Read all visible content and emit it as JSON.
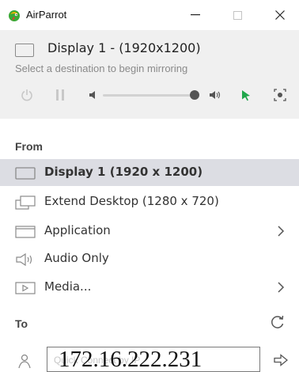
{
  "window": {
    "title": "AirParrot",
    "controls": {
      "minimize": "—",
      "maximize": "☐",
      "close": "✕"
    }
  },
  "status": {
    "display_title": "Display 1 - (1920x1200)",
    "subtitle": "Select a destination to begin mirroring",
    "volume_level": 0.98,
    "accent_color": "#1fa64a"
  },
  "from": {
    "label": "From",
    "items": [
      {
        "label": "Display 1 (1920 x 1200)",
        "icon": "display-icon",
        "selected": true,
        "has_submenu": false
      },
      {
        "label": "Extend Desktop (1280 x 720)",
        "icon": "extend-desktop-icon",
        "selected": false,
        "has_submenu": false
      },
      {
        "label": "Application",
        "icon": "application-icon",
        "selected": false,
        "has_submenu": true
      },
      {
        "label": "Audio Only",
        "icon": "speaker-icon",
        "selected": false,
        "has_submenu": false
      },
      {
        "label": "Media...",
        "icon": "media-icon",
        "selected": false,
        "has_submenu": true
      }
    ]
  },
  "to": {
    "label": "To",
    "ip_value": "172.16.222.231",
    "ip_placeholder": "Quick Connect by IP"
  }
}
